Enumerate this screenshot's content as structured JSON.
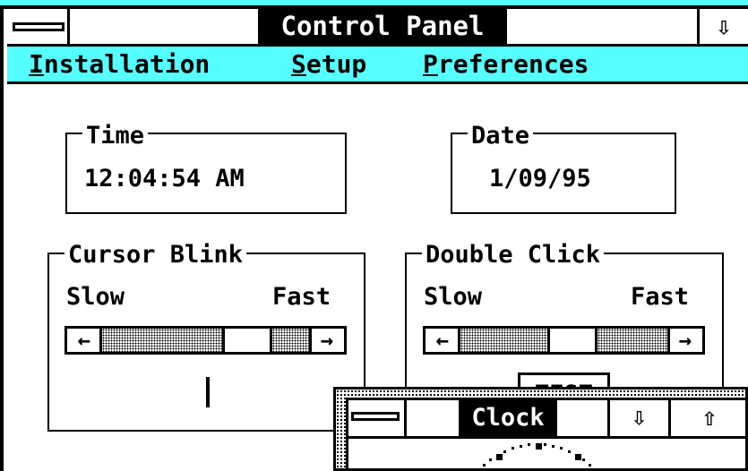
{
  "window": {
    "title": "Control Panel",
    "system_menu_icon": "system-menu-bar-icon",
    "minimize_icon": "down-arrow-icon"
  },
  "menu": {
    "installation": "Installation",
    "setup": "Setup",
    "preferences": "Preferences"
  },
  "time": {
    "legend": "Time",
    "value": "12:04:54 AM"
  },
  "date": {
    "legend": "Date",
    "value": "1/09/95"
  },
  "cursor_blink": {
    "legend": "Cursor Blink",
    "slow_label": "Slow",
    "fast_label": "Fast",
    "left_arrow": "←",
    "right_arrow": "→",
    "level": 0.75
  },
  "double_click": {
    "legend": "Double Click",
    "slow_label": "Slow",
    "fast_label": "Fast",
    "left_arrow": "←",
    "right_arrow": "→",
    "level": 0.55,
    "test_label": "TEST"
  },
  "clock_window": {
    "title": "Clock",
    "minimize_glyph": "⇩",
    "maximize_glyph": "⇧"
  },
  "colors": {
    "accent": "#55ffff",
    "foreground": "#000000",
    "background": "#ffffff"
  }
}
